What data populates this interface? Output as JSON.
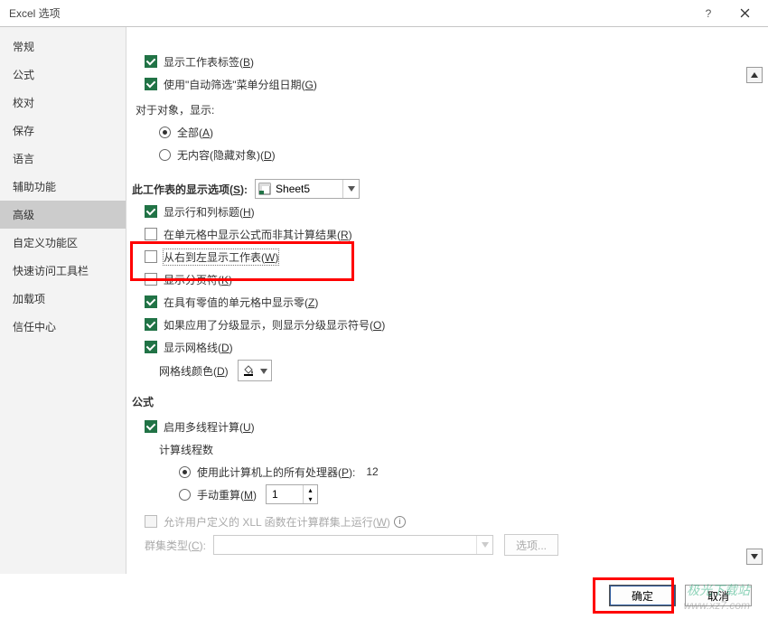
{
  "window": {
    "title": "Excel 选项"
  },
  "sidebar": {
    "items": [
      {
        "label": "常规"
      },
      {
        "label": "公式"
      },
      {
        "label": "校对"
      },
      {
        "label": "保存"
      },
      {
        "label": "语言"
      },
      {
        "label": "辅助功能"
      },
      {
        "label": "高级",
        "selected": true
      },
      {
        "label": "自定义功能区"
      },
      {
        "label": "快速访问工具栏"
      },
      {
        "label": "加载项"
      },
      {
        "label": "信任中心"
      }
    ]
  },
  "content": {
    "show_sheet_tabs": {
      "checked": true,
      "label": "显示工作表标签(B)"
    },
    "use_autofilter_date_grouping": {
      "checked": true,
      "label": "使用\"自动筛选\"菜单分组日期(G)"
    },
    "objects_show_header": "对于对象，显示:",
    "objects_all": {
      "checked": true,
      "label": "全部(A)"
    },
    "objects_none": {
      "checked": false,
      "label": "无内容(隐藏对象)(D)"
    },
    "sheet_display_header": "此工作表的显示选项(S):",
    "sheet_combo": "Sheet5",
    "show_row_col_headers": {
      "checked": true,
      "label": "显示行和列标题(H)"
    },
    "show_formulas_not_results": {
      "checked": false,
      "label": "在单元格中显示公式而非其计算结果(R)"
    },
    "right_to_left": {
      "checked": false,
      "label": "从右到左显示工作表(W)"
    },
    "show_page_breaks": {
      "checked": false,
      "label": "显示分页符(K)"
    },
    "show_zero_values": {
      "checked": true,
      "label": "在具有零值的单元格中显示零(Z)"
    },
    "show_outline_symbols": {
      "checked": true,
      "label": "如果应用了分级显示，则显示分级显示符号(O)"
    },
    "show_gridlines": {
      "checked": true,
      "label": "显示网格线(D)"
    },
    "gridline_color_label": "网格线颜色(D)",
    "formulas_header": "公式",
    "enable_multithread": {
      "checked": true,
      "label": "启用多线程计算(U)"
    },
    "threads_header": "计算线程数",
    "threads_all": {
      "checked": true,
      "label": "使用此计算机上的所有处理器(P):"
    },
    "threads_all_value": "12",
    "threads_manual": {
      "checked": false,
      "label": "手动重算(M)"
    },
    "threads_manual_value": "1",
    "udf_cluster": {
      "checked": false,
      "label": "允许用户定义的 XLL 函数在计算群集上运行(W)",
      "disabled": true
    },
    "cluster_type_label": "群集类型(C):",
    "cluster_options_btn": "选项..."
  },
  "footer": {
    "ok": "确定",
    "cancel": "取消"
  },
  "watermark": {
    "line1": "极光下载站",
    "line2": "www.xz7.com"
  }
}
